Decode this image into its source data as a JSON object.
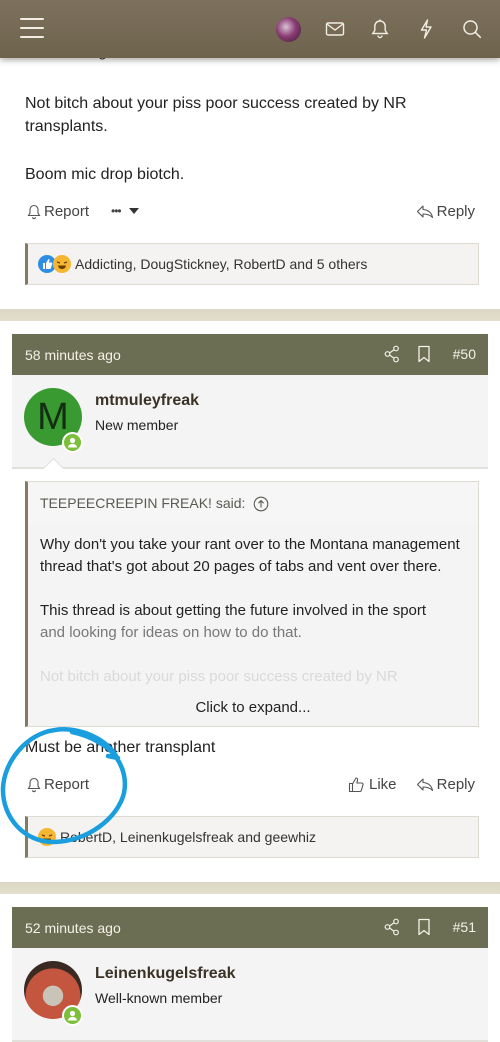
{
  "topbar": {
    "icons": [
      "hamburger-menu-icon",
      "user-avatar",
      "envelope-icon",
      "bell-icon",
      "lightning-icon",
      "search-icon"
    ]
  },
  "post49": {
    "cut_text": "and looking for ideas on how to do that.",
    "paragraphs": [
      "Not bitch about your piss poor success created by NR transplants.",
      "Boom mic drop biotch."
    ],
    "actions": {
      "report": "Report",
      "more": "•••",
      "reply": "Reply"
    },
    "reactions": {
      "icons": [
        "like",
        "haha"
      ],
      "text": "Addicting, DougStickney, RobertD and 5 others"
    }
  },
  "post50": {
    "time": "58 minutes ago",
    "number": "#50",
    "user": {
      "initial": "M",
      "avatar_color": "#3a9a32",
      "name": "mtmuleyfreak",
      "title": "New member"
    },
    "quote": {
      "author_line": "TEEPEECREEPIN FREAK! said:",
      "paragraphs": [
        "Why don't you take your rant over to the Montana management thread that's got about 20 pages of tabs and vent over there.",
        "This thread is about getting the future involved in the sport",
        "and looking for ideas on how to do that.",
        "Not bitch about your piss poor success created by NR"
      ],
      "expand_label": "Click to expand..."
    },
    "body": "Must be another transplant",
    "actions": {
      "report": "Report",
      "like": "Like",
      "reply": "Reply"
    },
    "reactions": {
      "icons": [
        "haha"
      ],
      "text": "RobertD, Leinenkugelsfreak and geewhiz"
    }
  },
  "post51": {
    "time": "52 minutes ago",
    "number": "#51",
    "user": {
      "name": "Leinenkugelsfreak",
      "title": "Well-known member"
    }
  },
  "annotation": {
    "color": "#1a9ede",
    "target": "report-button"
  }
}
